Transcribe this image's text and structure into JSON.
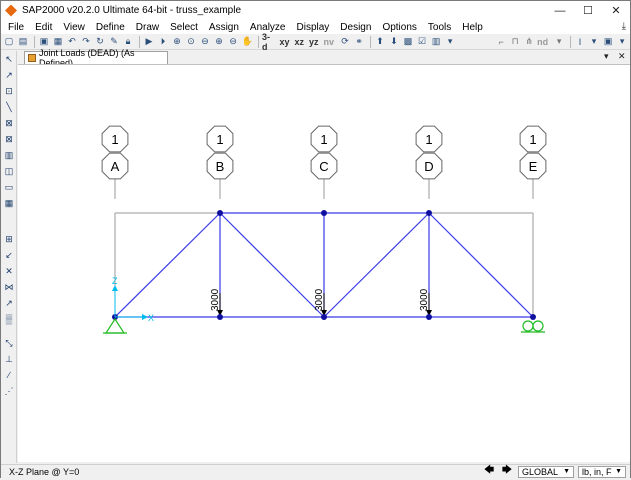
{
  "window": {
    "title": "SAP2000 v20.2.0 Ultimate 64-bit - truss_example",
    "minimize": "—",
    "maximize": "☐",
    "close": "✕"
  },
  "menu": {
    "items": [
      "File",
      "Edit",
      "View",
      "Define",
      "Draw",
      "Select",
      "Assign",
      "Analyze",
      "Display",
      "Design",
      "Options",
      "Tools",
      "Help"
    ],
    "download_icon": "download-icon"
  },
  "toolbar": {
    "view_3d": "3-d",
    "view_xy": "xy",
    "view_xz": "xz",
    "view_yz": "yz",
    "view_nv": "nv",
    "nd_label": "nd"
  },
  "tab": {
    "title": "Joint Loads (DEAD) (As Defined)",
    "close": "✕",
    "collapse": "▾"
  },
  "model": {
    "grid_top_labels": [
      "1",
      "1",
      "1",
      "1",
      "1"
    ],
    "grid_bottom_labels": [
      "A",
      "B",
      "C",
      "D",
      "E"
    ],
    "load_labels": [
      "3000",
      "3000",
      "3000"
    ],
    "axis_z": "Z",
    "axis_x": "X",
    "colors": {
      "member": "#3a3ae8",
      "joint": "#1010a0",
      "grid_line": "#9a9a9a",
      "support": "#22bb22",
      "axis": "#00bbee"
    }
  },
  "status": {
    "plane": "X-Z Plane @ Y=0",
    "coord_system": "GLOBAL",
    "units": "lb, in, F"
  }
}
